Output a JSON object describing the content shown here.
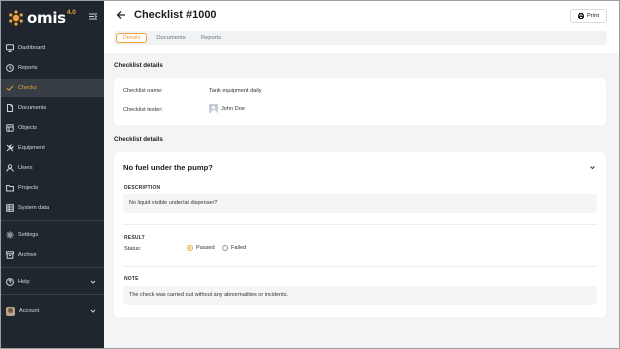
{
  "app": {
    "logo_text": "omis",
    "logo_version": "4.0",
    "brand_color": "#f0a239",
    "sidebar_bg": "#20262d"
  },
  "sidebar": {
    "items": [
      {
        "label": "Dashboard",
        "icon": "monitor-icon"
      },
      {
        "label": "Reports",
        "icon": "clock-icon"
      },
      {
        "label": "Checks",
        "icon": "check-icon",
        "active": true
      },
      {
        "label": "Documents",
        "icon": "file-icon"
      },
      {
        "label": "Objects",
        "icon": "box-icon"
      },
      {
        "label": "Equipment",
        "icon": "tools-icon"
      },
      {
        "label": "Users",
        "icon": "user-icon"
      },
      {
        "label": "Projects",
        "icon": "folder-icon"
      },
      {
        "label": "System data",
        "icon": "table-icon"
      },
      {
        "label": "Settings",
        "icon": "gear-icon"
      },
      {
        "label": "Archive",
        "icon": "archive-icon"
      },
      {
        "label": "Help",
        "icon": "help-icon"
      },
      {
        "label": "Account",
        "icon": "avatar"
      }
    ]
  },
  "header": {
    "title": "Checklist #1000",
    "print_label": "Print",
    "tabs": [
      {
        "label": "Details",
        "active": true
      },
      {
        "label": "Documents"
      },
      {
        "label": "Reports"
      }
    ]
  },
  "details": {
    "section_title": "Checklist details",
    "name_label": "Checklist name:",
    "name_value": "Tank equipment daily",
    "tester_label": "Checklist tester:",
    "tester_value": "John Doe"
  },
  "question": {
    "section_title": "Checklist details",
    "title": "No fuel under the pump?",
    "description_label": "DESCRIPTION",
    "description": "No liquid visible under/at dispenser?",
    "result_label": "RESULT",
    "status_label": "Status:",
    "options": [
      {
        "label": "Passed",
        "selected": true
      },
      {
        "label": "Failed",
        "selected": false
      }
    ],
    "note_label": "NOTE",
    "note": "The check was carried out without any abnormalities or incidents."
  }
}
